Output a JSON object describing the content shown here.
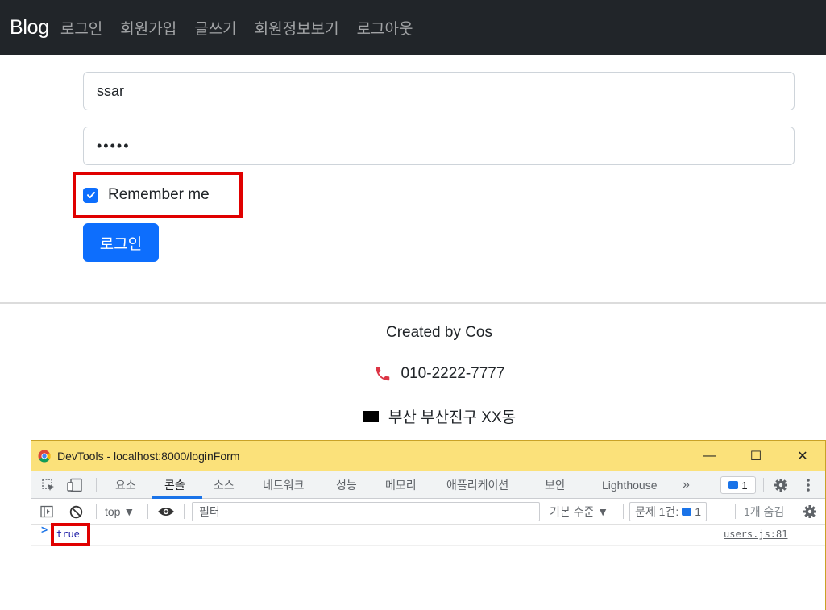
{
  "navbar": {
    "brand": "Blog",
    "links": [
      "로그인",
      "회원가입",
      "글쓰기",
      "회원정보보기",
      "로그아웃"
    ]
  },
  "form": {
    "username_value": "ssar",
    "password_value": "•••••",
    "remember_label": "Remember me",
    "remember_checked": true,
    "login_button": "로그인"
  },
  "footer": {
    "created": "Created by Cos",
    "phone": "010-2222-7777",
    "address": "부산 부산진구 XX동"
  },
  "devtools": {
    "title": "DevTools - localhost:8000/loginForm",
    "window_controls": {
      "minimize": "—",
      "maximize": "☐",
      "close": "✕"
    },
    "tabs": [
      "요소",
      "콘솔",
      "소스",
      "네트워크",
      "성능",
      "메모리",
      "애플리케이션",
      "보안",
      "Lighthouse"
    ],
    "active_tab": "콘솔",
    "more_tabs": "»",
    "issues_count": "1",
    "toolbar": {
      "context": "top ▼",
      "filter_placeholder": "필터",
      "level": "기본 수준 ▼",
      "issues_label": "문제 1건:",
      "issues_badge": "1",
      "hidden": "1개 숨김"
    },
    "console": {
      "log_value": "true",
      "log_source": "users.js:81",
      "prompt": ">"
    }
  },
  "colors": {
    "navbar_bg": "#212529",
    "primary": "#0d6efd",
    "highlight": "#e00000",
    "devtools_title_bg": "#fbe17a"
  }
}
